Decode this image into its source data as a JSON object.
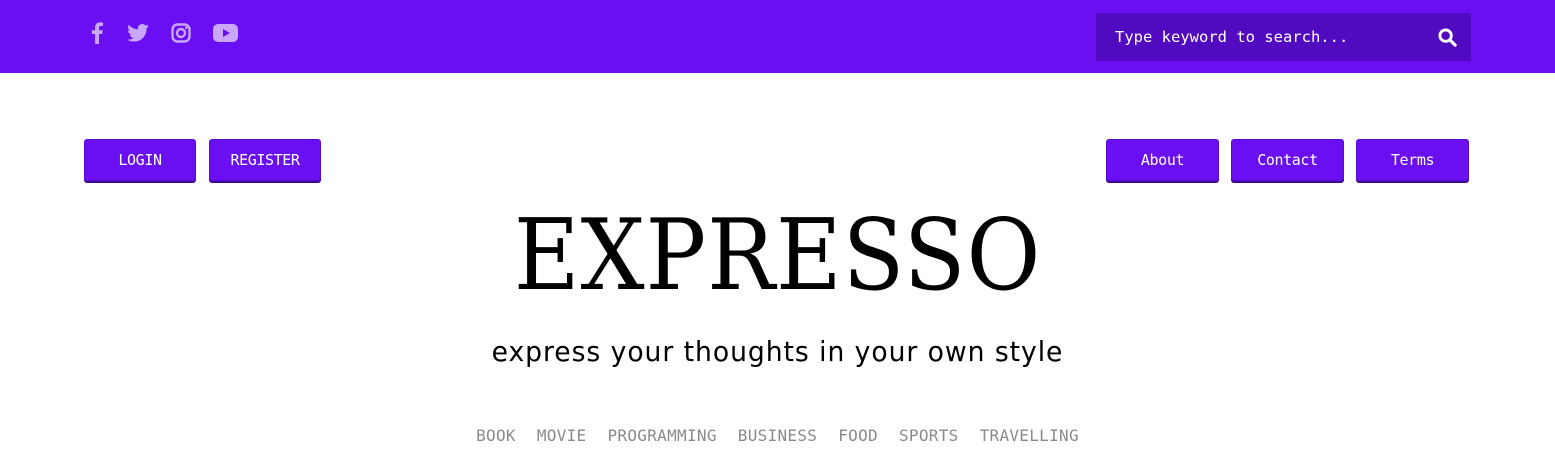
{
  "colors": {
    "brand": "#6a0ff2",
    "search_bg": "#520ac0",
    "social_icon": "#c9a7ff",
    "category_text": "#8a8a8a"
  },
  "social": {
    "icons": [
      "facebook-icon",
      "twitter-icon",
      "instagram-icon",
      "youtube-icon"
    ]
  },
  "search": {
    "placeholder": "Type keyword to search...",
    "icon": "search-icon"
  },
  "auth": {
    "login_label": "LOGIN",
    "register_label": "REGISTER"
  },
  "nav": {
    "about_label": "About",
    "contact_label": "Contact",
    "terms_label": "Terms"
  },
  "site": {
    "title": "EXPRESSO",
    "tagline": "express your thoughts in your own style"
  },
  "categories": [
    "BOOK",
    "MOVIE",
    "PROGRAMMING",
    "BUSINESS",
    "FOOD",
    "SPORTS",
    "TRAVELLING"
  ]
}
